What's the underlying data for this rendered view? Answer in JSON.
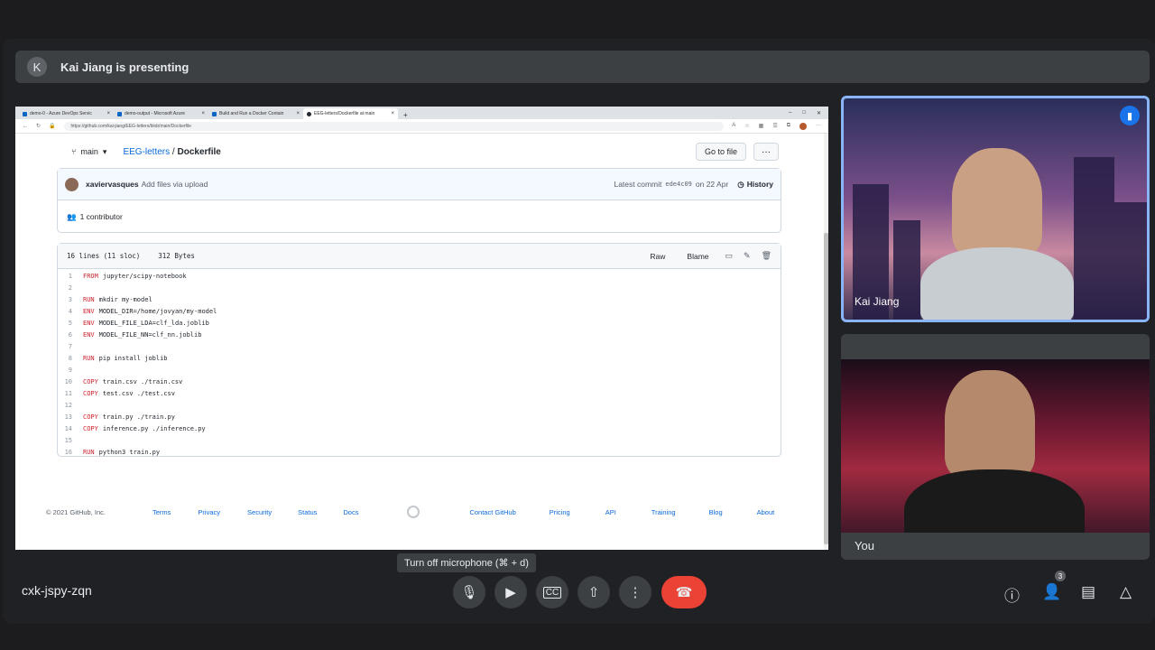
{
  "presenting": {
    "avatar_letter": "K",
    "text": "Kai Jiang is presenting"
  },
  "browser": {
    "tabs": [
      {
        "label": "demo-0 - Azure DevOps Servic"
      },
      {
        "label": "demo-output - Microsoft Azure"
      },
      {
        "label": "Build and Run a Docker Contain"
      },
      {
        "label": "EEG-letters/Dockerfile at main"
      }
    ],
    "url": "https://github.com/kai-jiang/EEG-letters/blob/main/Dockerfile"
  },
  "github": {
    "branch": "main",
    "repo": "EEG-letters",
    "separator": "/",
    "file": "Dockerfile",
    "go_to_file": "Go to file",
    "more": "···",
    "commit": {
      "user": "xaviervasques",
      "message": "Add files via upload",
      "latest_label": "Latest commit",
      "sha": "ede4c09",
      "date": "on 22 Apr",
      "history": "History"
    },
    "contributors": "1 contributor",
    "file_info": {
      "lines": "16 lines (11 sloc)",
      "size": "312 Bytes"
    },
    "actions": {
      "raw": "Raw",
      "blame": "Blame"
    },
    "code": [
      {
        "n": "1",
        "kw": "FROM",
        "arg": "jupyter/scipy-notebook"
      },
      {
        "n": "2",
        "kw": "",
        "arg": ""
      },
      {
        "n": "3",
        "kw": "RUN",
        "arg": "mkdir my-model"
      },
      {
        "n": "4",
        "kw": "ENV",
        "arg": "MODEL_DIR=/home/jovyan/my-model"
      },
      {
        "n": "5",
        "kw": "ENV",
        "arg": "MODEL_FILE_LDA=clf_lda.joblib"
      },
      {
        "n": "6",
        "kw": "ENV",
        "arg": "MODEL_FILE_NN=clf_nn.joblib"
      },
      {
        "n": "7",
        "kw": "",
        "arg": ""
      },
      {
        "n": "8",
        "kw": "RUN",
        "arg": "pip install joblib"
      },
      {
        "n": "9",
        "kw": "",
        "arg": ""
      },
      {
        "n": "10",
        "kw": "COPY",
        "arg": "train.csv ./train.csv"
      },
      {
        "n": "11",
        "kw": "COPY",
        "arg": "test.csv ./test.csv"
      },
      {
        "n": "12",
        "kw": "",
        "arg": ""
      },
      {
        "n": "13",
        "kw": "COPY",
        "arg": "train.py ./train.py"
      },
      {
        "n": "14",
        "kw": "COPY",
        "arg": "inference.py ./inference.py"
      },
      {
        "n": "15",
        "kw": "",
        "arg": ""
      },
      {
        "n": "16",
        "kw": "RUN",
        "arg": "python3 train.py"
      }
    ],
    "footer": {
      "copyright": "© 2021 GitHub, Inc.",
      "links": [
        "Terms",
        "Privacy",
        "Security",
        "Status",
        "Docs"
      ],
      "links_right": [
        "Contact GitHub",
        "Pricing",
        "API",
        "Training",
        "Blog",
        "About"
      ]
    }
  },
  "tiles": {
    "presenter_name": "Kai Jiang",
    "self_name": "You"
  },
  "tooltip": "Turn off microphone (⌘ + d)",
  "meeting_code": "cxk-jspy-zqn",
  "participants_count": "3",
  "colors": {
    "end_call": "#ea4335",
    "speaking": "#1a73e8",
    "tile_border": "#8ab4f8"
  },
  "icons": [
    "mic-icon",
    "camera-icon",
    "captions-icon",
    "present-icon",
    "more-icon",
    "end-call-icon",
    "info-icon",
    "people-icon",
    "chat-icon",
    "activities-icon"
  ]
}
